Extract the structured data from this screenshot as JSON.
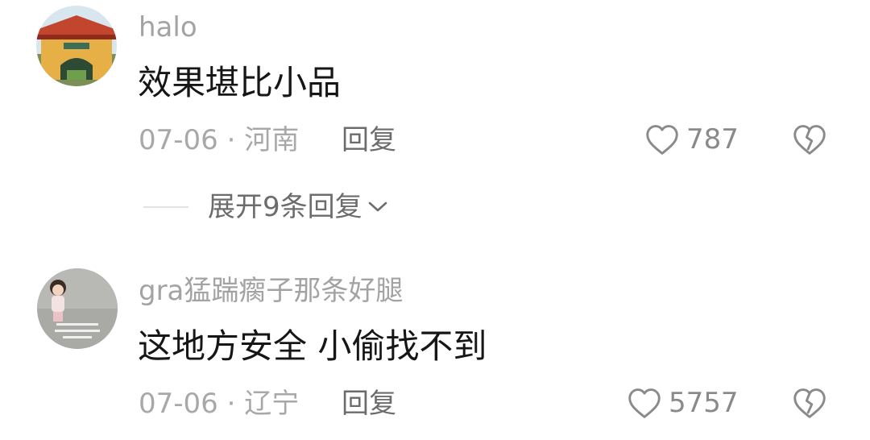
{
  "comments": [
    {
      "username": "halo",
      "text": "效果堪比小品",
      "date": "07-06",
      "separator": "·",
      "location": "河南",
      "reply_label": "回复",
      "likes": "787",
      "expand_label": "展开9条回复"
    },
    {
      "username": "gra猛踹瘸子那条好腿",
      "text": "这地方安全 小偷找不到",
      "date": "07-06",
      "separator": "·",
      "location": "辽宁",
      "reply_label": "回复",
      "likes": "5757"
    }
  ],
  "icons": {
    "like": "heart-outline-icon",
    "dislike": "broken-heart-icon",
    "expand": "chevron-down-icon"
  },
  "colors": {
    "username": "#a3a3a3",
    "text": "#161616",
    "meta": "#a8a8a8",
    "action": "#6c6c6c"
  }
}
